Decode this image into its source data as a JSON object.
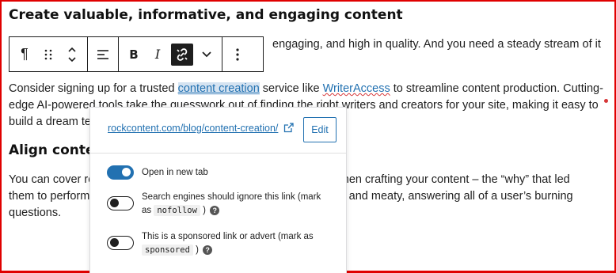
{
  "content": {
    "heading1": "Create valuable, informative, and engaging content",
    "para0_tail": "engaging, and high in quality. And you need a steady stream of it",
    "para1": {
      "before_link1": "Consider signing up for a trusted ",
      "link1": "content creation",
      "between": " service like ",
      "link2": "WriterAccess",
      "after": " to streamline content production. Cutting-",
      "line2": "edge AI-powered tools take the guesswork out of finding the right writers and creators for your site, making it easy to",
      "line3": "build a dream team of content creators."
    },
    "heading2_start": "Align content",
    "heading2_end": "s",
    "para2": {
      "line1_start": "You can cover re",
      "line1_end": "when crafting your content – the “why” that led",
      "line2_start": "them to perform",
      "line2_end": "ul and meaty, answering all of a user’s burning",
      "line3": "questions."
    }
  },
  "toolbar": {
    "paragraph": "¶",
    "drag": "⠿",
    "mover": "⌃⌄",
    "align": "☰",
    "bold": "B",
    "italic": "I",
    "more_rich": "⌄",
    "options": "⋮"
  },
  "popover": {
    "url": "rockcontent.com/blog/content-creation/",
    "edit_label": "Edit",
    "options": [
      {
        "label": "Open in new tab",
        "checked": true
      },
      {
        "label_line1": "Search engines should ignore this link (mark",
        "label_line2_pre": "as",
        "code": "nofollow",
        "label_line2_post": ")",
        "checked": false
      },
      {
        "label_line1": "This is a sponsored link or advert (mark as",
        "code": "sponsored",
        "label_line2_post": ")",
        "checked": false
      }
    ]
  },
  "colors": {
    "frame": "#e00000",
    "link": "#2271b1",
    "toggle_on": "#2271b1",
    "text": "#1e1e1e"
  },
  "icons": {
    "paragraph": "paragraph-icon",
    "drag": "drag-handle-icon",
    "mover": "move-up-down-icon",
    "align": "align-left-icon",
    "link": "unlink-icon",
    "external": "external-link-icon",
    "help": "help-icon"
  }
}
